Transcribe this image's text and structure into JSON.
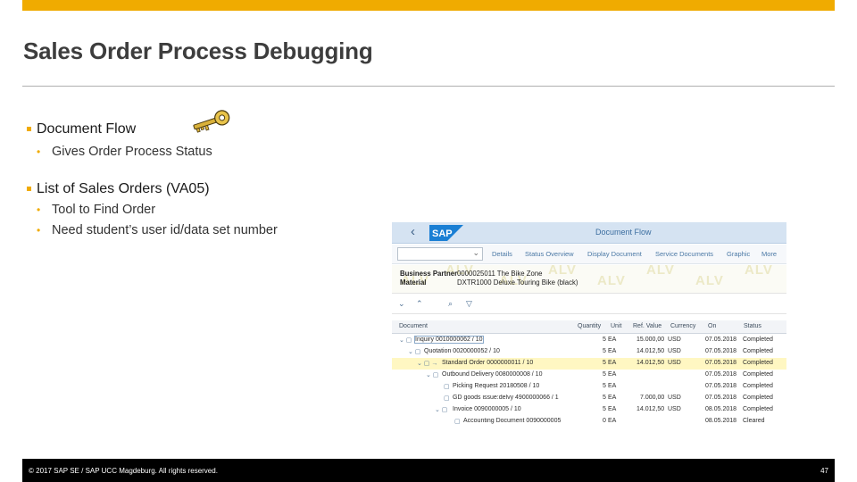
{
  "slide": {
    "title": "Sales Order Process Debugging",
    "bullets": [
      {
        "text": "Document Flow",
        "sub": [
          "Gives Order Process Status"
        ]
      },
      {
        "text": "List of Sales Orders (VA05)",
        "sub": [
          "Tool to Find Order",
          "Need student’s user id/data set number"
        ]
      }
    ],
    "footer": {
      "copyright": "© 2017 SAP SE / SAP UCC Magdeburg. All rights reserved.",
      "page": "47"
    },
    "accent_color": "#f0ab00"
  },
  "screenshot": {
    "logo_text": "SAP",
    "title": "Document Flow",
    "toolbar": [
      "Details",
      "Status Overview",
      "Display Document",
      "Service Documents",
      "Graphic",
      "More"
    ],
    "business_partner_label": "Business Partner",
    "business_partner_value": "0000025011 The Bike Zone",
    "material_label": "Material",
    "material_value": "DXTR1000 Deluxe Touring Bike (black)",
    "watermark": "ALV",
    "columns": [
      "Document",
      "Quantity",
      "Unit",
      "Ref. Value",
      "Currency",
      "On",
      "Status"
    ],
    "rows": [
      {
        "doc": "Inquiry 0010000062 / 10",
        "qty": "5",
        "unit": "EA",
        "net": "15.000,00",
        "cur": "USD",
        "on": "07.05.2018",
        "status": "Completed"
      },
      {
        "doc": "Quotation 0020000052 / 10",
        "qty": "5",
        "unit": "EA",
        "net": "14.012,50",
        "cur": "USD",
        "on": "07.05.2018",
        "status": "Completed"
      },
      {
        "doc": "Standard Order 0000000011 / 10",
        "qty": "5",
        "unit": "EA",
        "net": "14.012,50",
        "cur": "USD",
        "on": "07.05.2018",
        "status": "Completed"
      },
      {
        "doc": "Outbound Delivery 0080000008 / 10",
        "qty": "5",
        "unit": "EA",
        "net": "",
        "cur": "",
        "on": "07.05.2018",
        "status": "Completed"
      },
      {
        "doc": "Picking Request 20180508 / 10",
        "qty": "5",
        "unit": "EA",
        "net": "",
        "cur": "",
        "on": "07.05.2018",
        "status": "Completed"
      },
      {
        "doc": "GD goods issue:delvy 4900000066 / 1",
        "qty": "5",
        "unit": "EA",
        "net": "7.000,00",
        "cur": "USD",
        "on": "07.05.2018",
        "status": "Completed"
      },
      {
        "doc": "Invoice 0090000005 / 10",
        "qty": "5",
        "unit": "EA",
        "net": "14.012,50",
        "cur": "USD",
        "on": "08.05.2018",
        "status": "Completed"
      },
      {
        "doc": "Accounting Document 0090000005",
        "qty": "0",
        "unit": "EA",
        "net": "",
        "cur": "",
        "on": "08.05.2018",
        "status": "Cleared"
      }
    ]
  }
}
